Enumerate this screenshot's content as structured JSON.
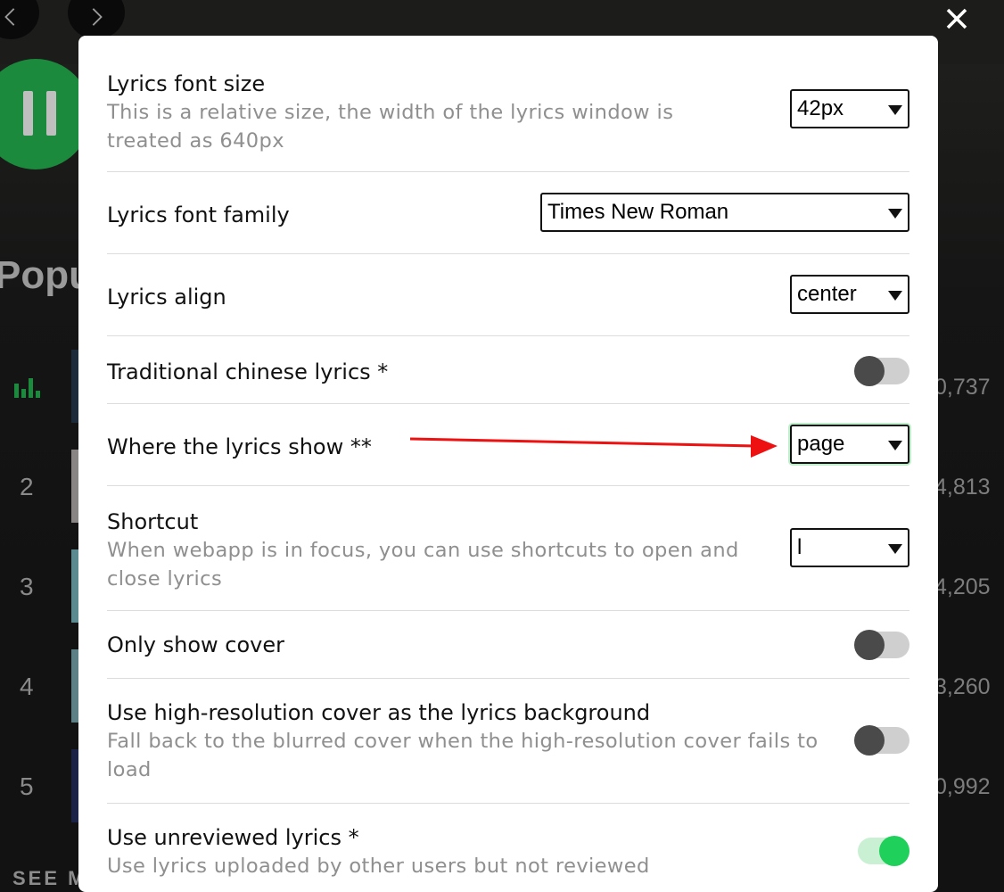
{
  "background": {
    "section_title": "Popu",
    "tracks": [
      {
        "number": "",
        "plays": "0,737"
      },
      {
        "number": "2",
        "plays": "4,813"
      },
      {
        "number": "3",
        "plays": "4,205"
      },
      {
        "number": "4",
        "plays": "3,260"
      },
      {
        "number": "5",
        "plays": "0,992"
      }
    ],
    "see_more": "SEE M"
  },
  "settings": [
    {
      "label": "Lyrics font size",
      "description": "This is a relative size, the width of the lyrics window is treated as 640px",
      "control": "select",
      "value": "42px"
    },
    {
      "label": "Lyrics font family",
      "description": "",
      "control": "select",
      "value": "Times New Roman"
    },
    {
      "label": "Lyrics align",
      "description": "",
      "control": "select",
      "value": "center"
    },
    {
      "label": "Traditional chinese lyrics *",
      "description": "",
      "control": "toggle",
      "checked": false
    },
    {
      "label": "Where the lyrics show **",
      "description": "",
      "control": "select",
      "value": "page"
    },
    {
      "label": "Shortcut",
      "description": "When webapp is in focus, you can use shortcuts to open and close lyrics",
      "control": "select",
      "value": "l"
    },
    {
      "label": "Only show cover",
      "description": "",
      "control": "toggle",
      "checked": false
    },
    {
      "label": "Use high-resolution cover as the lyrics background",
      "description": "Fall back to the blurred cover when the high-resolution cover fails to load",
      "control": "toggle",
      "checked": false
    },
    {
      "label": "Use unreviewed lyrics *",
      "description": "Use lyrics uploaded by other users but not reviewed",
      "control": "toggle",
      "checked": true
    }
  ],
  "colors": {
    "accent_green": "#1fd05a",
    "annotation_arrow": "#ee1111",
    "spotify_green": "#1c8a3d"
  },
  "icons": [
    "back-arrow-icon",
    "forward-arrow-icon",
    "pause-icon",
    "equalizer-icon",
    "close-icon",
    "caret-down-icon",
    "annotation-arrow"
  ]
}
